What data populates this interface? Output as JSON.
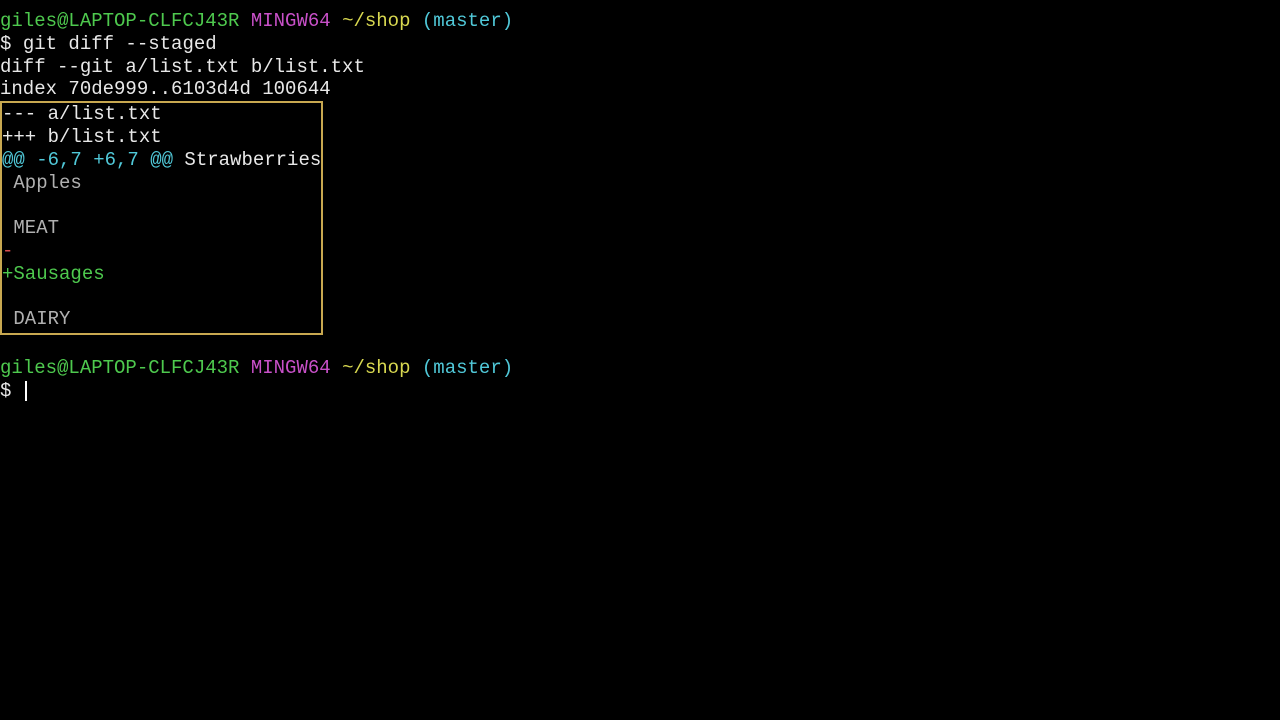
{
  "prompt1": {
    "user_host": "giles@LAPTOP-CLFCJ43R",
    "env": " MINGW64",
    "path": " ~/shop",
    "branch": " (master)",
    "symbol": "$ ",
    "command": "git diff --staged"
  },
  "diff": {
    "header": "diff --git a/list.txt b/list.txt",
    "index": "index 70de999..6103d4d 100644",
    "file_a": "--- a/list.txt",
    "file_b": "+++ b/list.txt",
    "hunk_prefix": "@@ -6,7 +6,7 @@",
    "hunk_context": " Strawberries",
    "ctx1": " Apples",
    "ctx2": " ",
    "ctx3": " MEAT",
    "removed": "-",
    "added": "+Sausages",
    "ctx4": " ",
    "ctx5": " DAIRY"
  },
  "prompt2": {
    "user_host": "giles@LAPTOP-CLFCJ43R",
    "env": " MINGW64",
    "path": " ~/shop",
    "branch": " (master)",
    "symbol": "$ "
  }
}
